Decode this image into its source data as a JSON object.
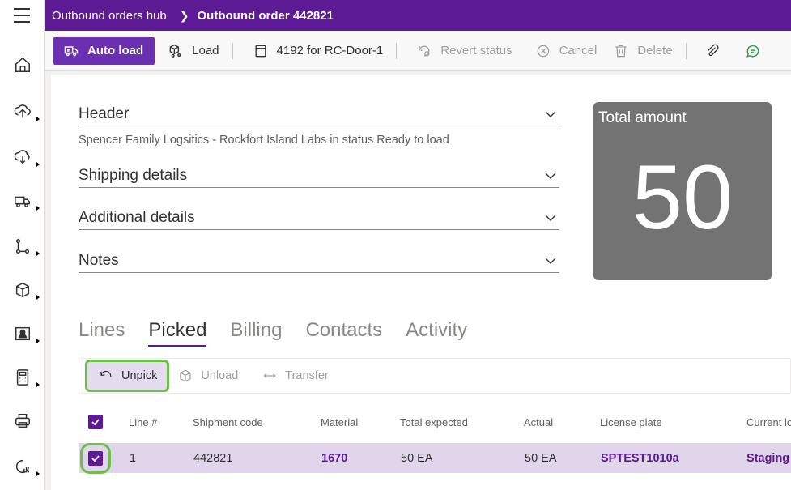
{
  "breadcrumb": {
    "parent": "Outbound orders hub",
    "current": "Outbound order 442821"
  },
  "nav": {
    "icons": [
      "home-icon",
      "upload-icon",
      "receive-icon",
      "truck-icon",
      "flow-icon",
      "package-icon",
      "contact-card-icon",
      "calculator-icon",
      "printer-icon",
      "analytics-icon"
    ]
  },
  "actions": {
    "auto_load": "Auto load",
    "load": "Load",
    "door": "4192 for RC-Door-1",
    "revert_status": "Revert status",
    "cancel": "Cancel",
    "delete": "Delete"
  },
  "sections": {
    "header": "Header",
    "header_summary": "Spencer Family Logsitics - Rockfort Island Labs in status Ready to load",
    "shipping": "Shipping details",
    "additional": "Additional details",
    "notes": "Notes"
  },
  "tile": {
    "title": "Total amount",
    "value": "50"
  },
  "tabs": [
    "Lines",
    "Picked",
    "Billing",
    "Contacts",
    "Activity"
  ],
  "active_tab": "Picked",
  "subactions": {
    "unpick": "Unpick",
    "unload": "Unload",
    "transfer": "Transfer"
  },
  "grid": {
    "columns": [
      "Line #",
      "Shipment code",
      "Material",
      "Total expected",
      "Actual",
      "License plate",
      "Current lo"
    ],
    "rows": [
      {
        "line": "1",
        "shipment": "442821",
        "material": "1670",
        "expected": "50 EA",
        "actual": "50 EA",
        "plate": "SPTEST1010a",
        "location": "Staging"
      }
    ]
  },
  "colors": {
    "brand": "#5c1a94",
    "primary_button": "#6b2fb1",
    "highlight": "#6cc04a",
    "tile": "#737373",
    "row_selected": "#e1d5ec"
  }
}
